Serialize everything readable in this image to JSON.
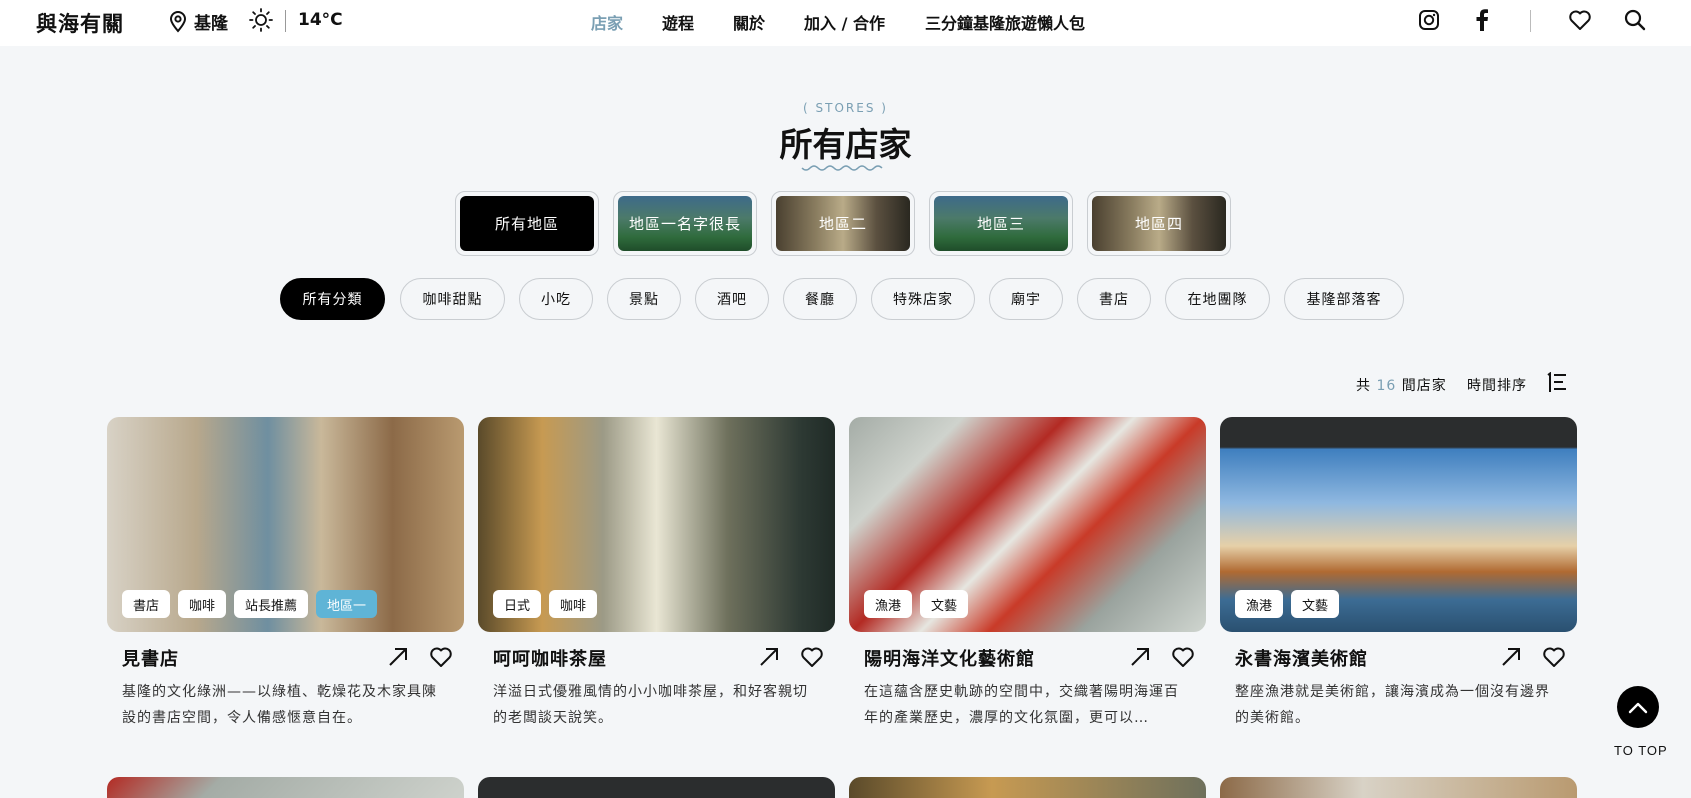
{
  "header": {
    "logo": "與海有關",
    "location": "基隆",
    "temperature": "14°C",
    "nav": [
      "店家",
      "遊程",
      "關於",
      "加入 / 合作",
      "三分鐘基隆旅遊懶人包"
    ]
  },
  "section": {
    "eyebrow": "( STORES )",
    "title": "所有店家"
  },
  "regions": [
    "所有地區",
    "地區一名字很長",
    "地區二",
    "地區三",
    "地區四"
  ],
  "categories": [
    "所有分類",
    "咖啡甜點",
    "小吃",
    "景點",
    "酒吧",
    "餐廳",
    "特殊店家",
    "廟宇",
    "書店",
    "在地團隊",
    "基隆部落客"
  ],
  "listing": {
    "count_prefix": "共",
    "count": "16",
    "count_suffix": "間店家",
    "sort_label": "時間排序"
  },
  "cards": [
    {
      "title": "見書店",
      "tags": [
        "書店",
        "咖啡",
        "站長推薦"
      ],
      "region_tag": "地區一",
      "desc": "基隆的文化綠洲——以綠植、乾燥花及木家具陳設的書店空間，令人備感愜意自在。"
    },
    {
      "title": "呵呵咖啡茶屋",
      "tags": [
        "日式",
        "咖啡"
      ],
      "region_tag": "",
      "desc": "洋溢日式優雅風情的小小咖啡茶屋，和好客親切的老闆談天說笑。"
    },
    {
      "title": "陽明海洋文化藝術館",
      "tags": [
        "漁港",
        "文藝"
      ],
      "region_tag": "",
      "desc": "在這蘊含歷史軌跡的空間中，交織著陽明海運百年的產業歷史，濃厚的文化氛圍，更可以…"
    },
    {
      "title": "永書海濱美術館",
      "tags": [
        "漁港",
        "文藝"
      ],
      "region_tag": "",
      "desc": "整座漁港就是美術館，讓海濱成為一個沒有邊界的美術館。"
    }
  ],
  "to_top": "TO TOP"
}
